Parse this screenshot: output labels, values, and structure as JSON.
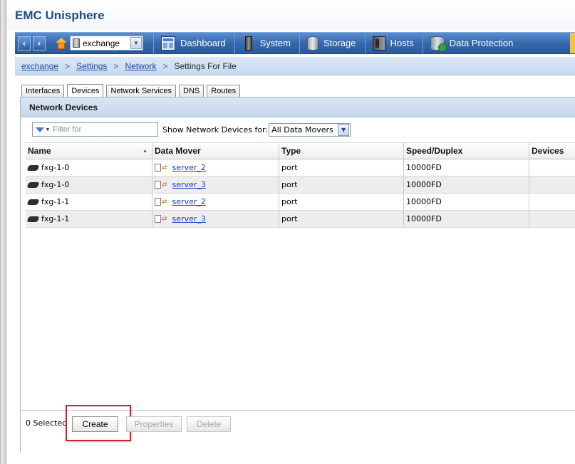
{
  "app": {
    "title": "EMC Unisphere"
  },
  "navbar": {
    "system_selector": {
      "value": "exchange"
    },
    "tabs": [
      {
        "label": "Dashboard",
        "icon": "dashboard-icon"
      },
      {
        "label": "System",
        "icon": "system-icon"
      },
      {
        "label": "Storage",
        "icon": "storage-icon"
      },
      {
        "label": "Hosts",
        "icon": "hosts-icon"
      },
      {
        "label": "Data Protection",
        "icon": "data-protection-icon"
      }
    ]
  },
  "breadcrumb": {
    "items": [
      "exchange",
      "Settings",
      "Network"
    ],
    "separator": ">",
    "current": "Settings For File"
  },
  "tabs": [
    {
      "label": "Interfaces",
      "active": false
    },
    {
      "label": "Devices",
      "active": true
    },
    {
      "label": "Network Services",
      "active": false
    },
    {
      "label": "DNS",
      "active": false
    },
    {
      "label": "Routes",
      "active": false
    }
  ],
  "panel": {
    "title": "Network Devices",
    "filter_placeholder": "Filter for",
    "show_label": "Show Network Devices for:",
    "show_value": "All Data Movers"
  },
  "table": {
    "columns": [
      "Name",
      "Data Mover",
      "Type",
      "Speed/Duplex",
      "Devices"
    ],
    "rows": [
      {
        "name": "fxg-1-0",
        "data_mover": "server_2",
        "type": "port",
        "speed": "10000FD",
        "devices": ""
      },
      {
        "name": "fxg-1-0",
        "data_mover": "server_3",
        "type": "port",
        "speed": "10000FD",
        "devices": ""
      },
      {
        "name": "fxg-1-1",
        "data_mover": "server_2",
        "type": "port",
        "speed": "10000FD",
        "devices": ""
      },
      {
        "name": "fxg-1-1",
        "data_mover": "server_3",
        "type": "port",
        "speed": "10000FD",
        "devices": ""
      }
    ]
  },
  "footer": {
    "selected_count": "0 Selected",
    "create_label": "Create",
    "properties_label": "Properties",
    "delete_label": "Delete"
  },
  "colors": {
    "nav_blue": "#3569ad",
    "title_blue": "#1d4f8c",
    "highlight_red": "#c6262e",
    "link_blue": "#1a3cc8"
  }
}
